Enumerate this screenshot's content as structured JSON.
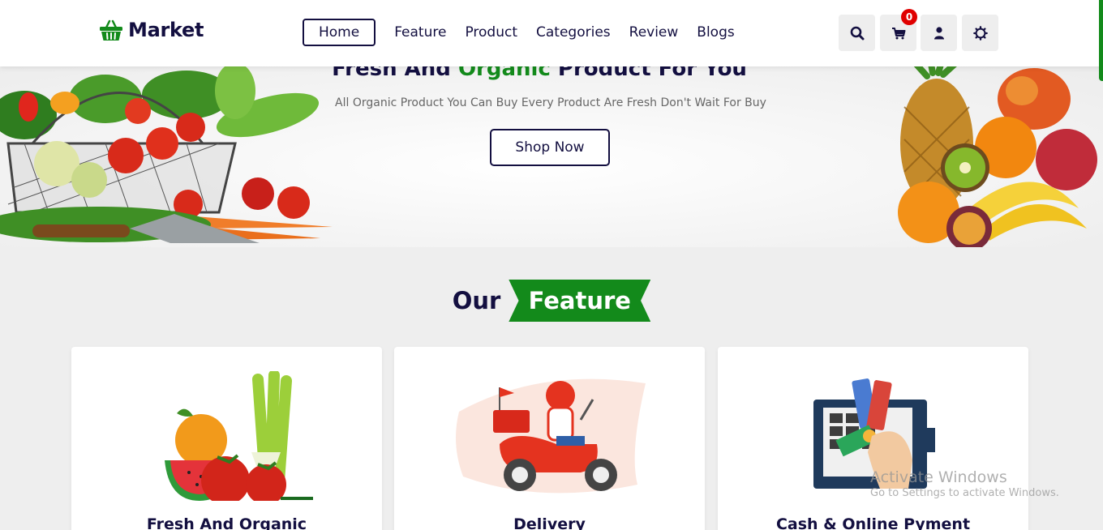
{
  "brand": {
    "name": "Market",
    "icon": "basket-icon",
    "color": "#138a1b"
  },
  "nav": {
    "links": [
      {
        "label": "Home",
        "active": true
      },
      {
        "label": "Feature"
      },
      {
        "label": "Product"
      },
      {
        "label": "Categories"
      },
      {
        "label": "Review"
      },
      {
        "label": "Blogs"
      }
    ]
  },
  "header_icons": {
    "search": "search-icon",
    "cart": "shopping-cart-icon",
    "cart_count": "0",
    "user": "user-icon",
    "settings": "gear-icon"
  },
  "hero": {
    "title_before": "Fresh And ",
    "title_accent": "Organic",
    "title_after": " Product For You",
    "subtitle": "All Organic Product You Can Buy Every Product Are Fresh Don't Wait For Buy",
    "button": "Shop Now"
  },
  "features": {
    "heading_plain": "Our",
    "heading_accent": "Feature",
    "cards": [
      {
        "title": "Fresh And Organic",
        "image": "fresh-produce-illustration"
      },
      {
        "title": "Delivery",
        "image": "delivery-scooter-illustration"
      },
      {
        "title": "Cash & Online Pyment",
        "image": "payment-terminal-illustration"
      }
    ]
  },
  "watermark": {
    "title": "Activate Windows",
    "subtitle": "Go to Settings to activate Windows."
  },
  "colors": {
    "navy": "#130f40",
    "green": "#138a1b",
    "badge": "#e00000",
    "background": "#eeeeee"
  }
}
